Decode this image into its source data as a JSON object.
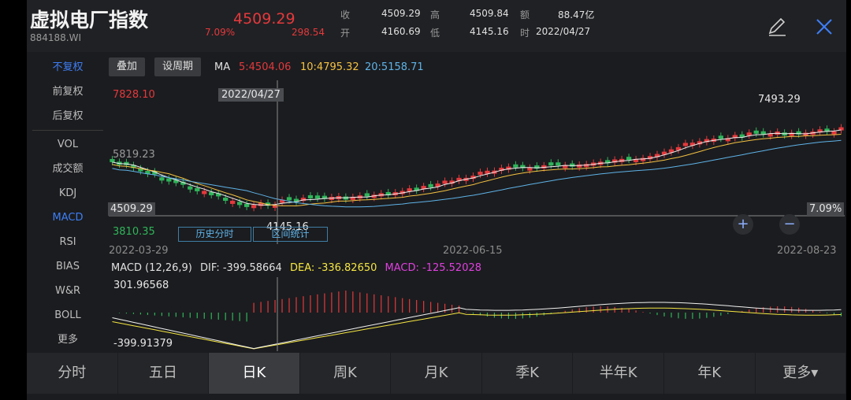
{
  "header": {
    "title": "虚拟电厂指数",
    "code": "884188.WI",
    "price": "4509.29",
    "change_pct": "7.09%",
    "change": "298.54",
    "quote": [
      {
        "l1": "收",
        "v1": "4509.29",
        "l2": "高",
        "v2": "4509.84",
        "l3": "额",
        "v3": "88.47亿"
      },
      {
        "l1": "开",
        "v1": "4160.69",
        "l2": "低",
        "v2": "4145.16",
        "l3": "时",
        "v3": "2022/04/27"
      }
    ],
    "edit_icon": "edit-icon",
    "close_icon": "close-icon"
  },
  "sidebar": {
    "items": [
      "不复权",
      "前复权",
      "后复权",
      "VOL",
      "成交额",
      "KDJ",
      "MACD",
      "RSI",
      "BIAS",
      "W&R",
      "BOLL",
      "更多"
    ],
    "active": "不复权",
    "active_indicator": "MACD"
  },
  "toolbar": {
    "overlay_label": "叠加",
    "period_label": "设周期",
    "ma_label": "MA",
    "ma5": "5:4504.06",
    "ma10": "10:4795.32",
    "ma20": "20:5158.71"
  },
  "price_chart": {
    "y_max": "7828.10",
    "y_mid": "5819.23",
    "y_min": "3810.35",
    "crosshair_price": "4509.29",
    "crosshair_pct": "7.09%",
    "crosshair_date": "2022/04/27",
    "high_label": "7493.29",
    "low_label": "4145.16",
    "x_dates": [
      "2022-03-29",
      "2022-06-15",
      "2022-08-23"
    ],
    "history_button": "历史分时",
    "range_button": "区间统计",
    "zoom_in": "+",
    "zoom_out": "−"
  },
  "macd": {
    "title": "MACD (12,26,9)",
    "dif": "DIF: -399.58664",
    "dea": "DEA: -336.82650",
    "macd": "MACD: -125.52028",
    "y_max": "301.96568",
    "y_min": "-399.91379"
  },
  "tabs": [
    "分时",
    "五日",
    "日K",
    "周K",
    "月K",
    "季K",
    "半年K",
    "年K",
    "更多▾"
  ],
  "active_tab": "日K",
  "colors": {
    "up": "#e4393c",
    "down": "#2fb55a",
    "ma5": "#f0f0f0",
    "ma10": "#f5c242",
    "ma20": "#5fb3e8",
    "accent": "#3d7ef5",
    "macd": "#e040e0"
  }
}
